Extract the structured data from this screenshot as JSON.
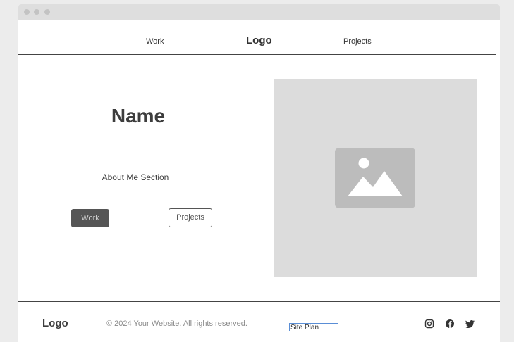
{
  "nav": {
    "work_label": "Work",
    "logo": "Logo",
    "projects_label": "Projects"
  },
  "hero": {
    "name": "Name",
    "about": "About Me Section",
    "work_button": "Work",
    "projects_button": "Projects",
    "image_icon": "image-placeholder-icon"
  },
  "footer": {
    "logo": "Logo",
    "copyright": "© 2024 Your Website. All rights reserved.",
    "site_plan": "Site Plan",
    "social_icons": [
      "instagram-icon",
      "facebook-icon",
      "twitter-icon"
    ]
  },
  "colors": {
    "background": "#ececec",
    "window": "#ffffff",
    "titlebar": "#dedede",
    "placeholder": "#dcdcdc",
    "primary_button": "#555555",
    "link_outline": "#5a8ed6"
  }
}
